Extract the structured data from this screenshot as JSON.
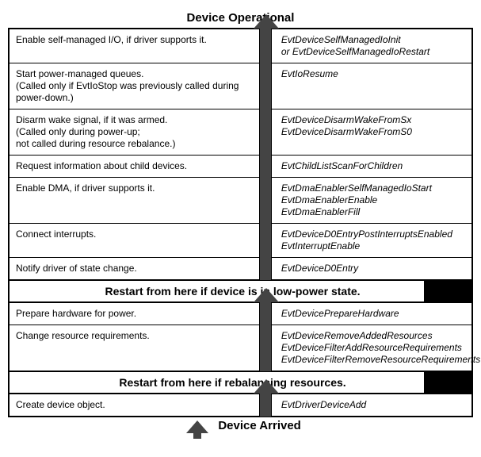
{
  "title_top": "Device Operational",
  "title_bottom": "Device Arrived",
  "separator1": "Restart from here if device is in low-power state.",
  "separator2": "Restart from here if rebalancing resources.",
  "rows_top": [
    {
      "left": "Enable self-managed I/O, if driver supports it.",
      "right": "EvtDeviceSelfManagedIoInit\nor EvtDeviceSelfManagedIoRestart"
    },
    {
      "left": "Start power-managed queues.\n(Called only if EvtIoStop was previously called during power-down.)",
      "right": "EvtIoResume"
    },
    {
      "left": "Disarm wake signal, if it was armed.\n(Called only during power-up;\nnot called during resource rebalance.)",
      "right": "EvtDeviceDisarmWakeFromSx\nEvtDeviceDisarmWakeFromS0"
    },
    {
      "left": "Request information about child devices.",
      "right": "EvtChildListScanForChildren"
    },
    {
      "left": "Enable DMA, if driver supports it.",
      "right": "EvtDmaEnablerSelfManagedIoStart\nEvtDmaEnablerEnable\nEvtDmaEnablerFill"
    },
    {
      "left": "Connect interrupts.",
      "right": "EvtDeviceD0EntryPostInterruptsEnabled\nEvtInterruptEnable"
    },
    {
      "left": "Notify driver of state change.",
      "right": "EvtDeviceD0Entry"
    }
  ],
  "rows_mid": [
    {
      "left": "Prepare hardware for power.",
      "right": "EvtDevicePrepareHardware"
    },
    {
      "left": "Change resource requirements.",
      "right": "EvtDeviceRemoveAddedResources\nEvtDeviceFilterAddResourceRequirements\nEvtDeviceFilterRemoveResourceRequirements"
    }
  ],
  "rows_bot": [
    {
      "left": "Create device object.",
      "right": "EvtDriverDeviceAdd"
    }
  ]
}
